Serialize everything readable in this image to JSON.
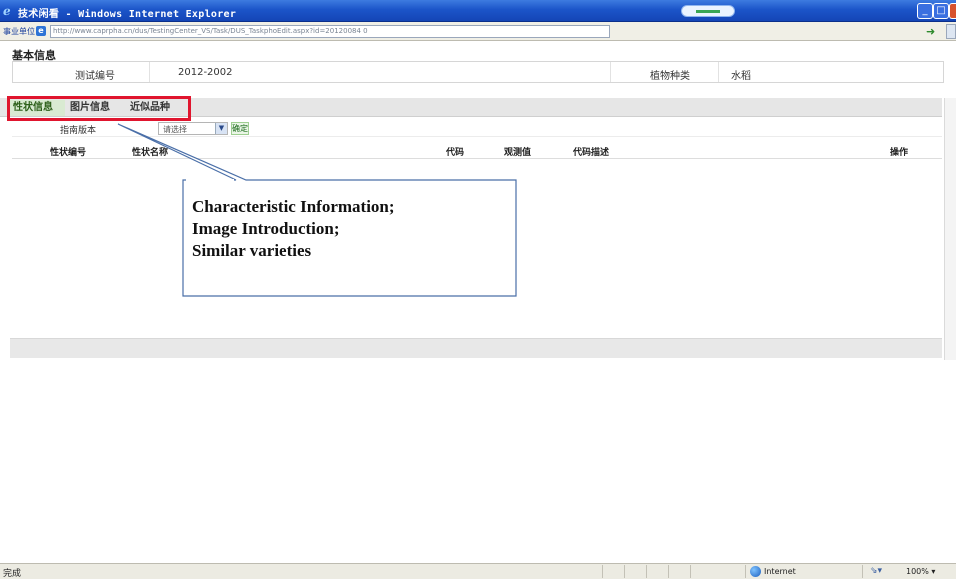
{
  "window": {
    "title": "技术闲看 - Windows Internet Explorer"
  },
  "browser": {
    "favorites_label": "事业单位",
    "url": "http://www.caprpha.cn/dus/TestingCenter_VS/Task/DUS_TaskphoEdit.aspx?id=20120084 0"
  },
  "basic_info": {
    "section_title": "基本信息",
    "test_no_label": "测试编号",
    "test_no_value": "2012-2002",
    "crop_label": "植物种类",
    "crop_value": "水稻"
  },
  "tabs": [
    {
      "label": "性状信息",
      "active": true
    },
    {
      "label": "图片信息",
      "active": false
    },
    {
      "label": "近似品种",
      "active": false
    }
  ],
  "filter": {
    "guide_label": "指南版本",
    "select_value": "请选择",
    "confirm_label": "确定"
  },
  "table": {
    "columns": [
      "性状编号",
      "性状名称",
      "代码",
      "观测值",
      "代码描述",
      "操作"
    ],
    "rows": []
  },
  "callout": {
    "lines": [
      "Characteristic Information;",
      "Image Introduction;",
      "Similar varieties"
    ]
  },
  "statusbar": {
    "status": "完成",
    "zone": "Internet",
    "zoom": "100%"
  },
  "colors": {
    "titlebar": "#1c55c9",
    "active_tab_bg": "#d9ead2",
    "highlight_border": "#e0152e",
    "callout_border": "#4a6fa8"
  }
}
